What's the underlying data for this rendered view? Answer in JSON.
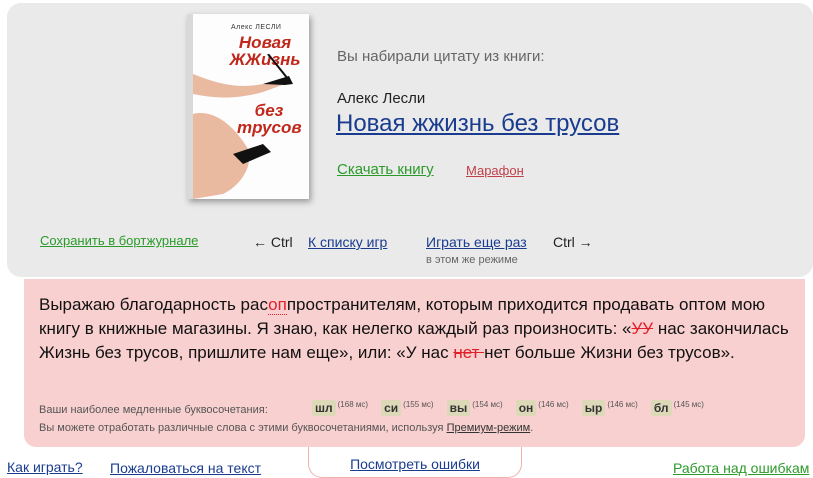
{
  "book": {
    "cover_author": "Алекс ЛЕСЛИ",
    "cover_title_line1": "Новая",
    "cover_title_line2": "ЖЖизнь",
    "cover_title_line3": "без",
    "cover_title_line4": "трусов",
    "typed_caption": "Вы набирали цитату из книги:",
    "author": "Алекс Лесли",
    "title": "Новая жжизнь без трусов",
    "download_label": "Скачать книгу",
    "mode_label": "Марафон"
  },
  "nav": {
    "save_label": "Сохранить в бортжурнале",
    "ctrl_left": "← Ctrl",
    "to_list_label": "К списку игр",
    "play_again_label": "Играть еще раз",
    "ctrl_right": "Ctrl →",
    "same_mode": "в этом же режиме"
  },
  "quote": {
    "p1": "Выражаю благодарность рас",
    "p1_err": "оп",
    "p2": "пространителям, которым приходится продавать оптом мою книгу в книжные магазины. Я знаю, как нелегко каждый раз произносить: «",
    "p2_err": "УУ",
    "p3": " нас закончилась Жизнь без трусов, пришлите нам еще», или: «У нас ",
    "p3_strike": "нет ",
    "p4": "нет больше Жизни без трусов»."
  },
  "stats": {
    "slow_caption": "Ваши наиболее медленные буквосочетания:",
    "combos": [
      {
        "text": "шл",
        "ms": "(168 мс)"
      },
      {
        "text": "си",
        "ms": "(155 мс)"
      },
      {
        "text": "вы",
        "ms": "(154 мс)"
      },
      {
        "text": "он",
        "ms": "(146 мс)"
      },
      {
        "text": "ыр",
        "ms": "(146 мс)"
      },
      {
        "text": "бл",
        "ms": "(145 мс)"
      }
    ],
    "practice_text": "Вы можете отработать различные слова с этими буквосочетаниями, используя ",
    "premium_label": "Премиум-режим",
    "practice_end": "."
  },
  "footer": {
    "how_play": "Как играть?",
    "complain": "Пожаловаться на текст",
    "view_errors": "Посмотреть ошибки",
    "work_errors": "Работа над ошибкам"
  },
  "colors": {
    "top_panel": "#eaeaea",
    "pink_panel": "#f9d0d0",
    "link_blue": "#1a3c8f",
    "link_green": "#2a9a2a",
    "error_red": "#e0202a"
  }
}
